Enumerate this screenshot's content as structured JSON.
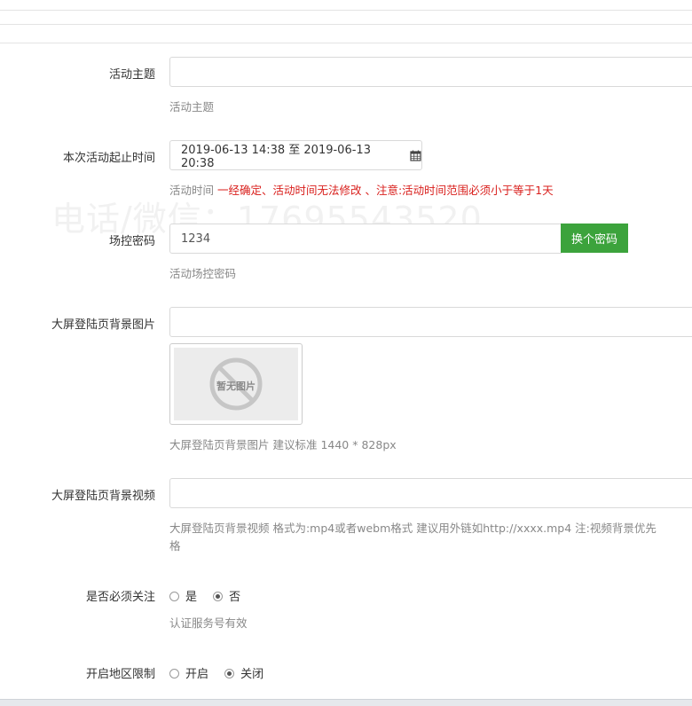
{
  "watermark": "电话/微信：17695543520",
  "fields": {
    "topic": {
      "label": "活动主题",
      "value": "",
      "help": "活动主题"
    },
    "time": {
      "label": "本次活动起止时间",
      "value": "2019-06-13 14:38 至 2019-06-13 20:38",
      "help_prefix": "活动时间 ",
      "help_red": "一经确定、活动时间无法修改 、注意:活动时间范围必须小于等于1天"
    },
    "password": {
      "label": "场控密码",
      "value": "1234",
      "button": "换个密码",
      "help": "活动场控密码"
    },
    "bg_image": {
      "label": "大屏登陆页背景图片",
      "value": "",
      "placeholder_text": "暂无图片",
      "help": "大屏登陆页背景图片 建议标准 1440 * 828px"
    },
    "bg_video": {
      "label": "大屏登陆页背景视频",
      "value": "",
      "help_line1": "大屏登陆页背景视频 格式为:mp4或者webm格式 建议用外链如http://xxxx.mp4 注:视频背景优先",
      "help_line2": "格"
    },
    "follow": {
      "label": "是否必须关注",
      "options": [
        "是",
        "否"
      ],
      "selected": "否",
      "help": "认证服务号有效"
    },
    "region": {
      "label": "开启地区限制",
      "options": [
        "开启",
        "关闭"
      ],
      "selected": "关闭"
    }
  }
}
